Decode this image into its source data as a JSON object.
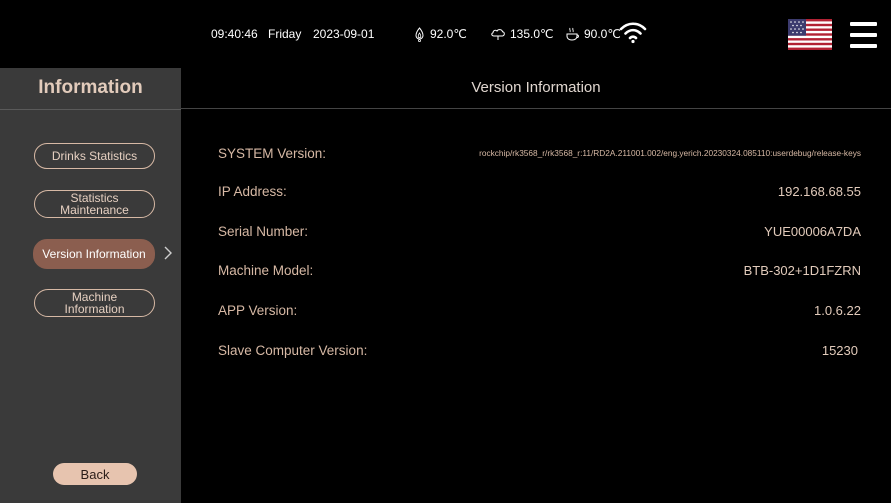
{
  "status_bar": {
    "time": "09:40:46",
    "day": "Friday",
    "date": "2023-09-01",
    "temps": [
      "92.0℃",
      "135.0℃",
      "90.0℃"
    ],
    "icons": [
      "boiler-icon",
      "steam-icon",
      "cup-icon",
      "wifi-icon",
      "us-flag-icon",
      "hamburger-menu-icon"
    ]
  },
  "sidebar": {
    "title": "Information",
    "items": [
      {
        "label": "Drinks Statistics",
        "active": false
      },
      {
        "label_line1": "Statistics",
        "label_line2": "Maintenance",
        "active": false
      },
      {
        "label": "Version Information",
        "active": true
      },
      {
        "label_line1": "Machine",
        "label_line2": "Information",
        "active": false
      }
    ],
    "back_label": "Back"
  },
  "main": {
    "title": "Version Information",
    "rows": [
      {
        "label": "SYSTEM Version:",
        "value": "rockchip/rk3568_r/rk3568_r:11/RD2A.211001.002/eng.yerich.20230324.085110:userdebug/release-keys"
      },
      {
        "label": "IP Address:",
        "value": "192.168.68.55"
      },
      {
        "label": "Serial Number:",
        "value": "YUE00006A7DA"
      },
      {
        "label": "Machine Model:",
        "value": "BTB-302+1D1FZRN"
      },
      {
        "label": "APP Version:",
        "value": "1.0.6.22"
      },
      {
        "label": "Slave Computer Version:",
        "value": "15230"
      }
    ]
  },
  "colors": {
    "accent": "#d7b9a5",
    "active_button": "#8b5e4f",
    "back_button": "#e7c4af",
    "sidebar_bg": "#3a3a3a",
    "background": "#000000"
  }
}
